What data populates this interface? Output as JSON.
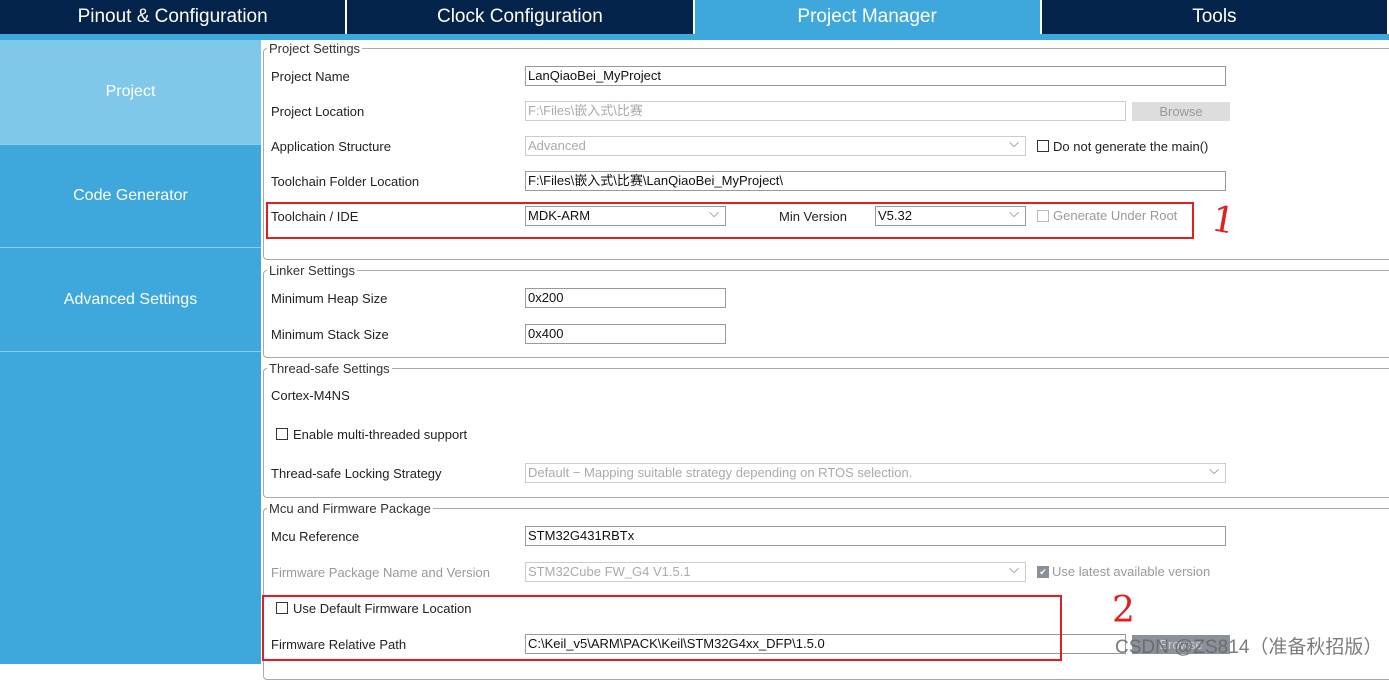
{
  "tabs": [
    "Pinout & Configuration",
    "Clock Configuration",
    "Project Manager",
    "Tools"
  ],
  "sidebar": [
    "Project",
    "Code Generator",
    "Advanced Settings"
  ],
  "project_settings": {
    "legend": "Project Settings",
    "project_name_label": "Project Name",
    "project_name": "LanQiaoBei_MyProject",
    "project_location_label": "Project Location",
    "project_location": "F:\\Files\\嵌入式\\比赛",
    "browse": "Browse",
    "app_structure_label": "Application Structure",
    "app_structure": "Advanced",
    "no_main_label": "Do not generate the main()",
    "toolchain_folder_label": "Toolchain Folder Location",
    "toolchain_folder": "F:\\Files\\嵌入式\\比赛\\LanQiaoBei_MyProject\\",
    "toolchain_label": "Toolchain / IDE",
    "toolchain": "MDK-ARM",
    "min_version_label": "Min Version",
    "min_version": "V5.32",
    "gen_under_root_label": "Generate Under Root"
  },
  "linker": {
    "legend": "Linker Settings",
    "heap_label": "Minimum Heap Size",
    "heap": "0x200",
    "stack_label": "Minimum Stack Size",
    "stack": "0x400"
  },
  "thread": {
    "legend": "Thread-safe Settings",
    "core": "Cortex-M4NS",
    "multi_label": "Enable multi-threaded support",
    "strategy_label": "Thread-safe Locking Strategy",
    "strategy": "Default  −  Mapping suitable strategy depending on RTOS selection."
  },
  "mcu": {
    "legend": "Mcu and Firmware Package",
    "ref_label": "Mcu Reference",
    "ref": "STM32G431RBTx",
    "fw_label": "Firmware Package Name and Version",
    "fw": "STM32Cube FW_G4 V1.5.1",
    "latest_label": "Use latest available version",
    "default_loc_label": "Use Default Firmware Location",
    "rel_path_label": "Firmware Relative Path",
    "rel_path": "C:\\Keil_v5\\ARM\\PACK\\Keil\\STM32G4xx_DFP\\1.5.0",
    "browse": "Browse"
  },
  "annotations": [
    "1",
    "2"
  ],
  "watermark": "CSDN @ZS814（准备秋招版）"
}
